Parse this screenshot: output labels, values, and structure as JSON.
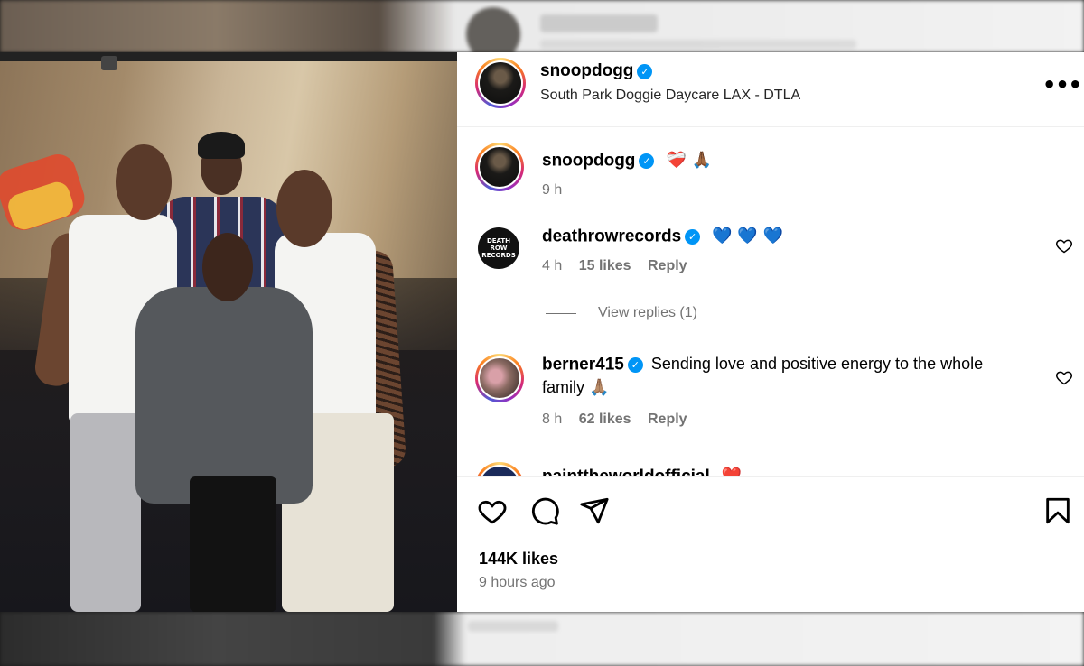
{
  "post": {
    "username": "snoopdogg",
    "location": "South Park Doggie Daycare LAX - DTLA",
    "more_icon": "more-horizontal-icon",
    "likes": "144K likes",
    "time_ago": "9 hours ago"
  },
  "caption": {
    "username": "snoopdogg",
    "text": "❤️‍🩹 🙏🏾",
    "time": "9 h"
  },
  "comments": [
    {
      "username": "deathrowrecords",
      "avatar_text": "DEATH ROW RECORDS",
      "text": "💙 💙 💙",
      "time": "4 h",
      "likes": "15 likes",
      "reply": "Reply",
      "view_replies": "View replies (1)"
    },
    {
      "username": "berner415",
      "text_part1": "Sending love and positive energy to the whole",
      "text_part2": "family 🙏🏽",
      "time": "8 h",
      "likes": "62 likes",
      "reply": "Reply"
    },
    {
      "username": "painttheworldofficial",
      "text": "❤️"
    }
  ],
  "colors": {
    "verified": "#0095f6",
    "meta_text": "#737373",
    "divider": "#efefef"
  },
  "icons": [
    "heart-icon",
    "comment-icon",
    "share-icon",
    "bookmark-icon",
    "verified-badge-icon"
  ]
}
